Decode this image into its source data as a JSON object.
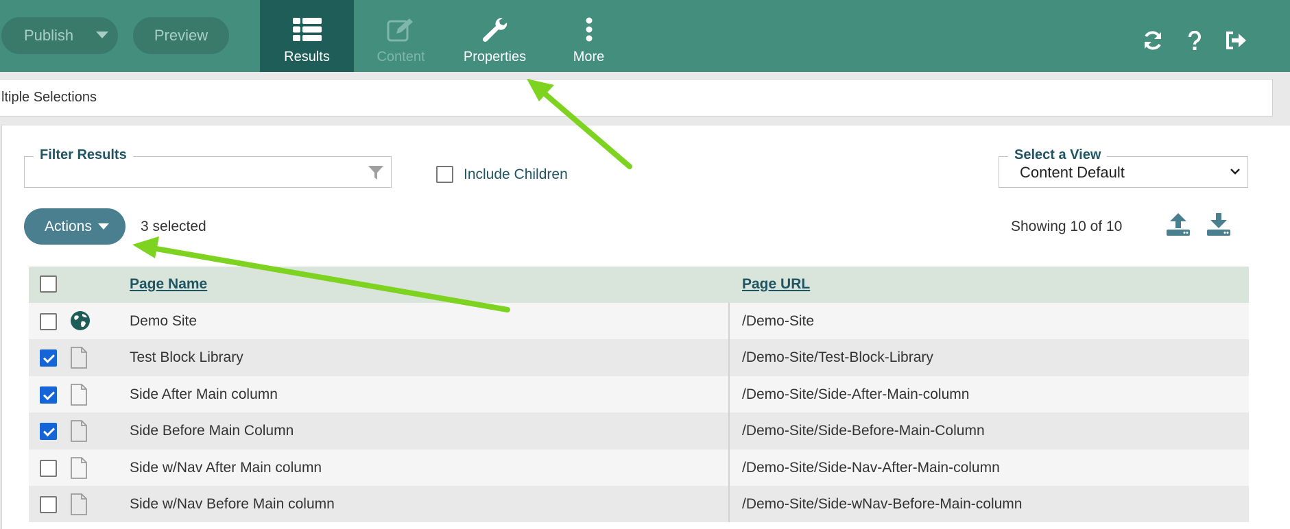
{
  "toolbar": {
    "publish_label": "Publish",
    "preview_label": "Preview",
    "tabs": [
      {
        "label": "Results",
        "icon": "list-icon",
        "active": true
      },
      {
        "label": "Content",
        "icon": "edit-icon",
        "disabled": true
      },
      {
        "label": "Properties",
        "icon": "wrench-icon"
      },
      {
        "label": "More",
        "icon": "more-vertical-icon"
      }
    ],
    "right_icons": [
      "refresh-icon",
      "help-icon",
      "logout-icon"
    ]
  },
  "breadcrumb": "ltiple Selections",
  "filter": {
    "legend": "Filter Results",
    "value": "",
    "include_children_label": "Include Children",
    "include_children_checked": false
  },
  "view": {
    "legend": "Select a View",
    "selected": "Content Default"
  },
  "actions": {
    "label": "Actions",
    "selected_count": "3 selected",
    "showing": "Showing 10 of 10"
  },
  "table": {
    "columns": [
      "Page Name",
      "Page URL"
    ],
    "rows": [
      {
        "name": "Demo Site",
        "url": "/Demo-Site",
        "checked": false,
        "icon": "globe-icon"
      },
      {
        "name": "Test Block Library",
        "url": "/Demo-Site/Test-Block-Library",
        "checked": true,
        "icon": "page-icon"
      },
      {
        "name": "Side After Main column",
        "url": "/Demo-Site/Side-After-Main-column",
        "checked": true,
        "icon": "page-icon"
      },
      {
        "name": "Side Before Main Column",
        "url": "/Demo-Site/Side-Before-Main-Column",
        "checked": true,
        "icon": "page-icon"
      },
      {
        "name": "Side w/Nav After Main column",
        "url": "/Demo-Site/Side-Nav-After-Main-column",
        "checked": false,
        "icon": "page-icon"
      },
      {
        "name": "Side w/Nav Before Main column",
        "url": "/Demo-Site/Side-wNav-Before-Main-column",
        "checked": false,
        "icon": "page-icon"
      }
    ]
  },
  "colors": {
    "toolbar": "#438e7c",
    "active_tab": "#1f5d58",
    "accent": "#4a7f8f",
    "checkbox": "#1565d8",
    "annotation_arrow": "#7ed321"
  }
}
